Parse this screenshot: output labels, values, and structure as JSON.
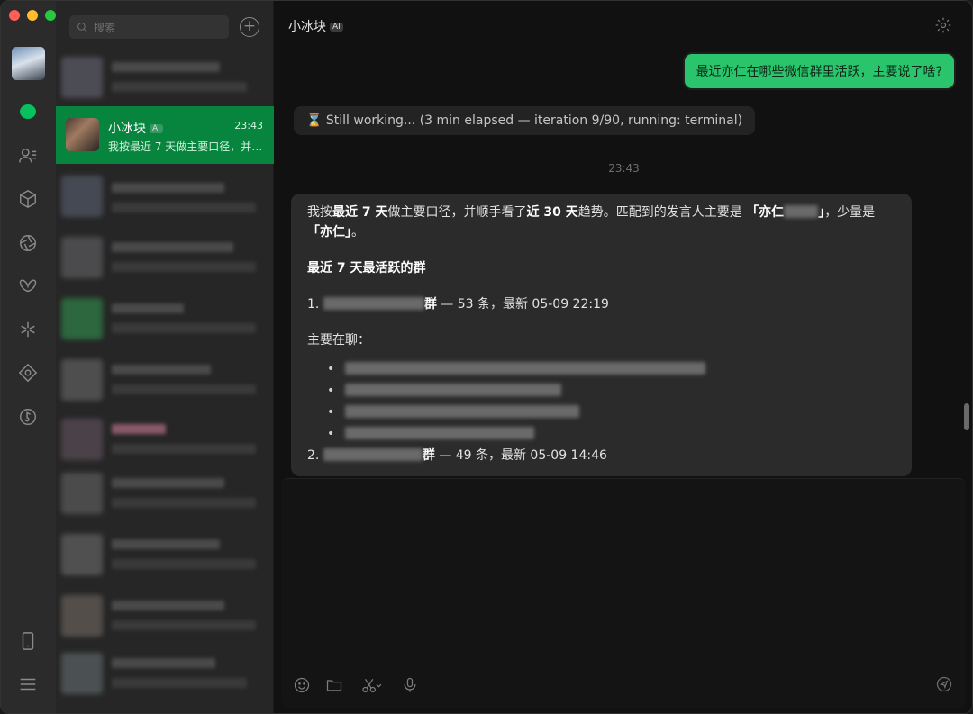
{
  "window": {
    "controls": [
      "close",
      "minimize",
      "maximize"
    ]
  },
  "colors": {
    "accent": "#07c160",
    "active_item": "#07853e",
    "bubble_out": "#29c46c"
  },
  "rail": {
    "icons": [
      "avatar",
      "chat-icon",
      "contacts-icon",
      "cube-icon",
      "aperture-icon",
      "butterfly-icon",
      "sparkle-icon",
      "diamond-icon",
      "music-icon",
      "phone-icon",
      "menu-icon"
    ]
  },
  "search": {
    "placeholder": "搜索"
  },
  "chat_list": {
    "active": {
      "name": "小冰块",
      "badge": "AI",
      "time": "23:43",
      "preview": "我按最近 7 天做主要口径，并…"
    }
  },
  "chat": {
    "title": "小冰块",
    "title_badge": "AI",
    "outgoing": "最近亦仁在哪些微信群里活跃，主要说了啥?",
    "status": "⌛ Still working... (3 min elapsed — iteration 9/90, running: terminal)",
    "timestamp": "23:43",
    "reply": {
      "intro_1": "我按",
      "intro_b1": "最近 7 天",
      "intro_2": "做主要口径，并顺手看了",
      "intro_b2": "近 30 天",
      "intro_3": "趋势。匹配到的发言人主要是 ",
      "intro_b3": "「亦仁",
      "intro_b3_end": "」",
      "intro_4": "，少量是",
      "intro_b4": "「亦仁」",
      "intro_5": "。",
      "heading": "最近 7 天最活跃的群",
      "item1_num": "1.",
      "item1_suffix": "群",
      "item1_stats": " — 53 条，最新 05-09 22:19",
      "topics_label": "主要在聊：",
      "item2_num": "2.",
      "item2_suffix": "群",
      "item2_stats": " — 49 条，最新 05-09 14:46"
    }
  }
}
